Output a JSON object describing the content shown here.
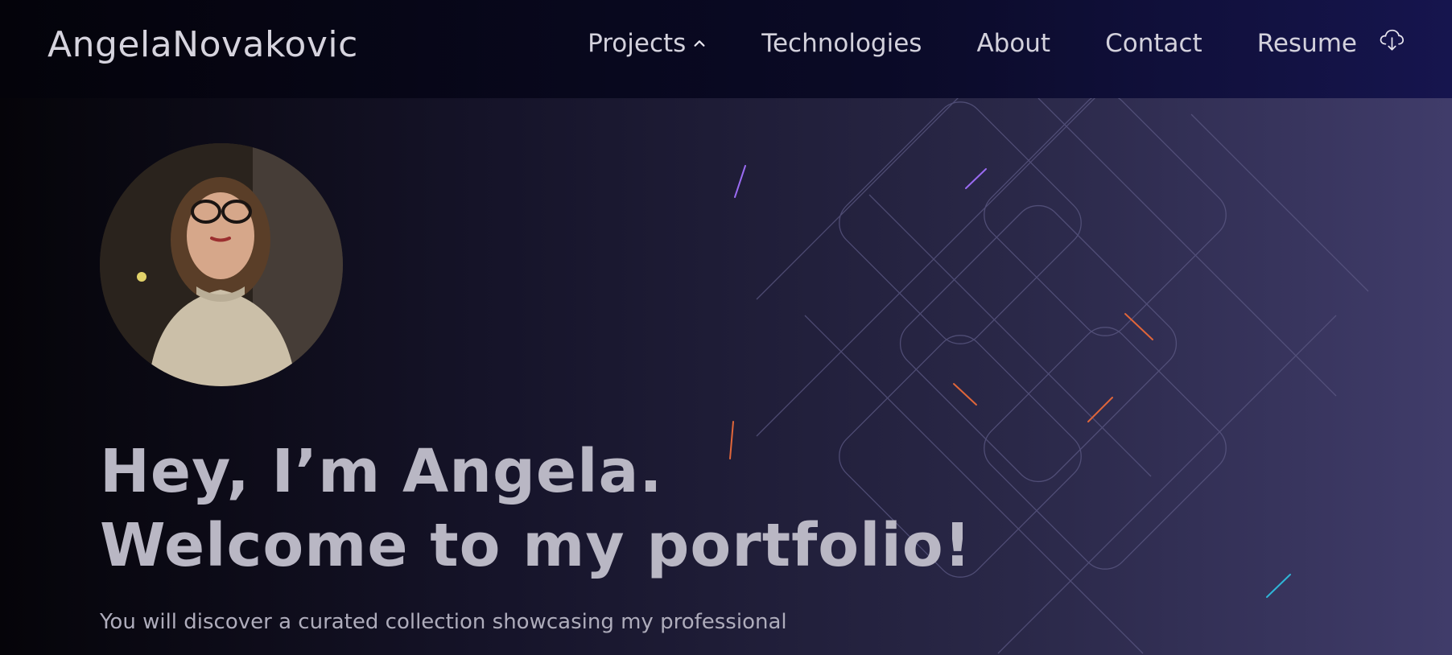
{
  "brand": "AngelaNovakovic",
  "nav": {
    "projects": "Projects",
    "technologies": "Technologies",
    "about": "About",
    "contact": "Contact",
    "resume": "Resume"
  },
  "hero": {
    "line1": "Hey, I’m Angela.",
    "line2": "Welcome to my portfolio!",
    "subtext": "You will discover a curated collection showcasing my professional"
  },
  "colors": {
    "accent_orange": "#e0663a",
    "accent_purple": "#9a6bf2",
    "accent_cyan": "#2fb6d8"
  },
  "icons": {
    "projects_toggle": "chevron-up-icon",
    "resume_download": "cloud-download-icon"
  }
}
